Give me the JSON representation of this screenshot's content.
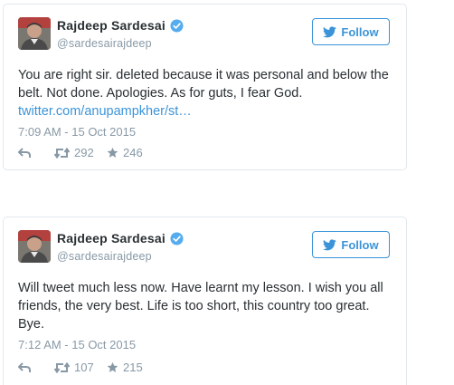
{
  "tweets": [
    {
      "author": {
        "name": "Rajdeep Sardesai",
        "handle": "@sardesairajdeep"
      },
      "follow_label": "Follow",
      "text": "You are right sir. deleted because it was personal and below the belt. Not done. Apologies. As for guts, I fear God.",
      "link": "twitter.com/anupampkher/st…",
      "timestamp": "7:09 AM - 15 Oct 2015",
      "retweets": "292",
      "likes": "246"
    },
    {
      "author": {
        "name": "Rajdeep Sardesai",
        "handle": "@sardesairajdeep"
      },
      "follow_label": "Follow",
      "text": "Will tweet much less now. Have learnt my lesson. I wish you all friends, the very best. Life is too short, this country too great. Bye.",
      "link": "",
      "timestamp": "7:12 AM - 15 Oct 2015",
      "retweets": "107",
      "likes": "215"
    }
  ],
  "colors": {
    "accent": "#3b94d9",
    "verified": "#55acee",
    "muted": "#8899a6",
    "text": "#292f33",
    "border": "#e1e8ed"
  },
  "icons": [
    "verified-badge-icon",
    "twitter-bird-icon",
    "reply-icon",
    "retweet-icon",
    "star-icon"
  ]
}
